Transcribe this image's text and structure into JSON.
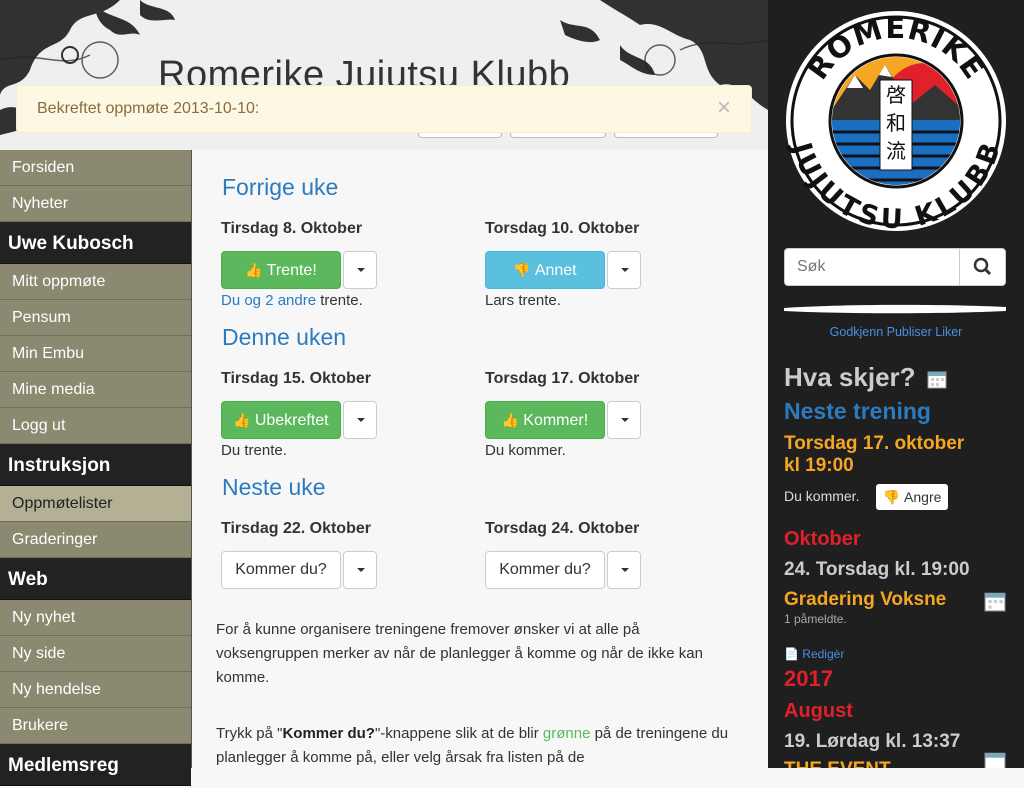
{
  "header": {
    "site_title": "Romerike Jujutsu Klubb"
  },
  "alert": {
    "text": "Bekreftet oppmøte 2013-10-10:",
    "close": "×"
  },
  "sidebar": {
    "top": [
      "Forsiden",
      "Nyheter"
    ],
    "user_heading": "Uwe Kubosch",
    "user_items": [
      "Mitt oppmøte",
      "Pensum",
      "Min Embu",
      "Mine media",
      "Logg ut"
    ],
    "instr_heading": "Instruksjon",
    "instr_items": [
      "Oppmøtelister",
      "Graderinger"
    ],
    "web_heading": "Web",
    "web_items": [
      "Ny nyhet",
      "Ny side",
      "Ny hendelse",
      "Brukere"
    ],
    "reg_heading": "Medlemsreg"
  },
  "weeks": [
    {
      "title": "Forrige uke",
      "days": [
        {
          "label": "Tirsdag 8. Oktober",
          "button": "Trente!",
          "style": "success",
          "icon": "thumbs-up",
          "note_link": "Du og 2 andre",
          "note_rest": " trente."
        },
        {
          "label": "Torsdag 10. Oktober",
          "button": "Annet",
          "style": "info",
          "icon": "thumbs-down",
          "note": "Lars trente."
        }
      ]
    },
    {
      "title": "Denne uken",
      "days": [
        {
          "label": "Tirsdag 15. Oktober",
          "button": "Ubekreftet",
          "style": "success",
          "icon": "thumbs-up",
          "note": "Du trente."
        },
        {
          "label": "Torsdag 17. Oktober",
          "button": "Kommer!",
          "style": "success",
          "icon": "thumbs-up",
          "note": "Du kommer."
        }
      ]
    },
    {
      "title": "Neste uke",
      "days": [
        {
          "label": "Tirsdag 22. Oktober",
          "button": "Kommer du?",
          "style": "default"
        },
        {
          "label": "Torsdag 24. Oktober",
          "button": "Kommer du?",
          "style": "default"
        }
      ]
    }
  ],
  "info": {
    "p1": "For å kunne organisere treningene fremover ønsker vi at alle på voksengruppen merker av når de planlegger å komme og når de ikke kan komme.",
    "p2_a": "Trykk på \"",
    "p2_b": "Kommer du?",
    "p2_c": "\"-knappene slik at de blir ",
    "p2_d": "grønne",
    "p2_e": " på de treningene du planlegger å komme på, eller velg årsak fra listen på de"
  },
  "right": {
    "logo_top": "ROMERIKE",
    "logo_bottom": "JUJUTSU KLUBB",
    "logo_kanji": [
      "啓",
      "和",
      "流"
    ],
    "search_placeholder": "Søk",
    "fb": "Godkjenn Publiser Liker",
    "hva_skjer": "Hva skjer?",
    "neste_trening": "Neste trening",
    "next_date": "Torsdag 17. oktober kl 19:00",
    "du_kommer": "Du kommer.",
    "angre": "Angre",
    "month1": "Oktober",
    "event1": "24. Torsdag kl. 19:00",
    "event1_title": "Gradering Voksne",
    "event1_sub": "1 påmeldte.",
    "rediger": "Redigèr",
    "year": "2017",
    "month2": "August",
    "event2": "19. Lørdag kl. 13:37",
    "event2_title": "THE EVENT"
  },
  "colors": {
    "accent": "#2c7bbf",
    "success": "#5cb85c",
    "info": "#5bc0de",
    "orange": "#f5a623",
    "red": "#e0202b"
  }
}
